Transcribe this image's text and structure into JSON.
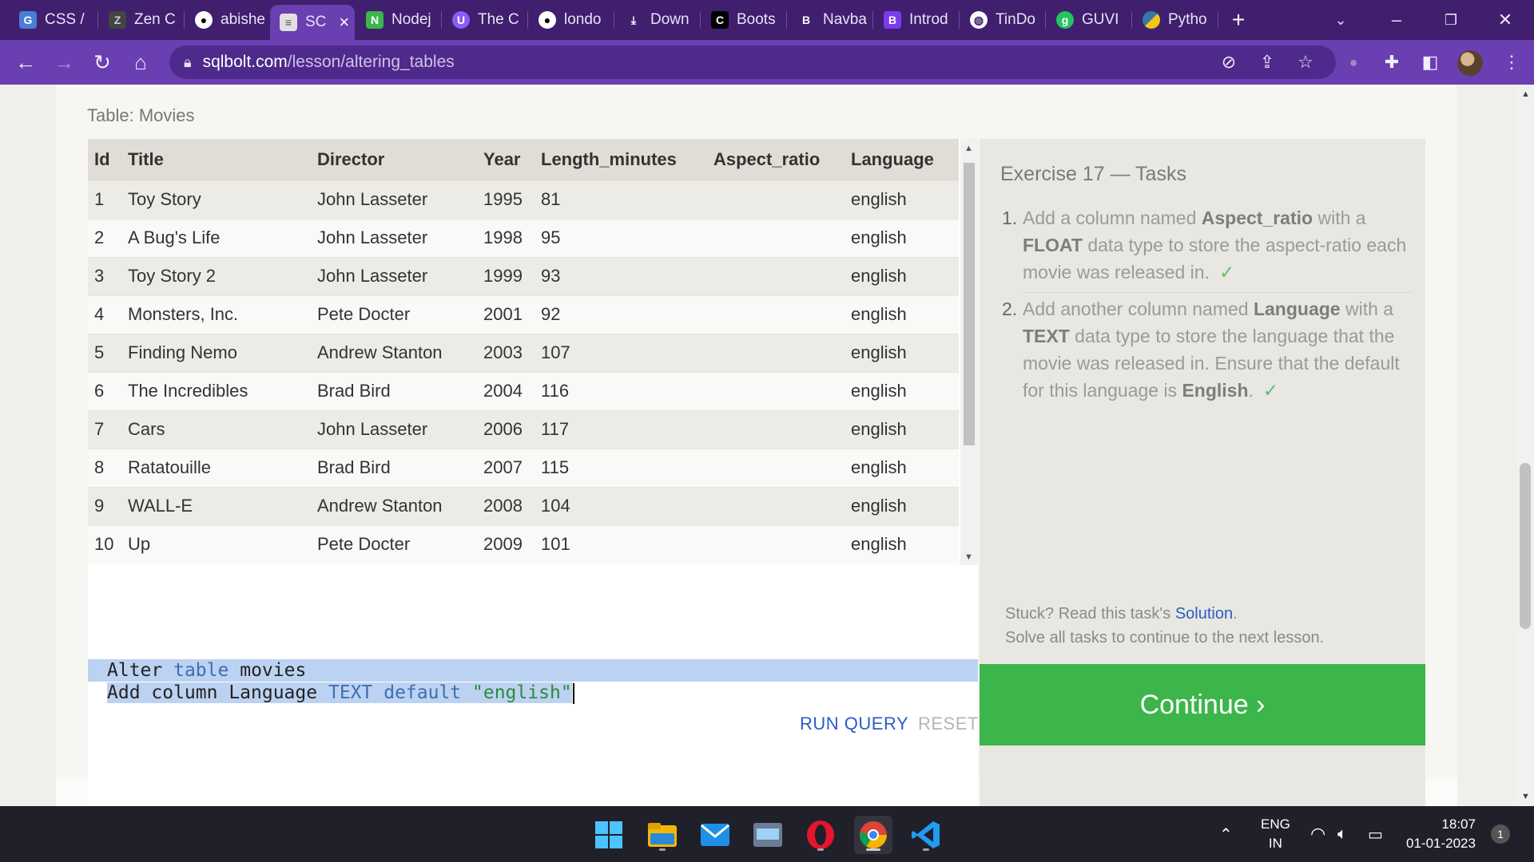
{
  "browser": {
    "tabs": [
      {
        "label": "CSS /",
        "icon": "docs-icon",
        "color": "#4a7fd6"
      },
      {
        "label": "Zen C",
        "icon": "zen-icon",
        "color": "#444444"
      },
      {
        "label": "abishe",
        "icon": "github-icon",
        "color": "#ffffff"
      },
      {
        "label": "SC",
        "icon": "database-icon",
        "color": "#e0e0e0"
      },
      {
        "label": "Nodej",
        "icon": "nodejs-icon",
        "color": "#3cb54a"
      },
      {
        "label": "The C",
        "icon": "theC-icon",
        "color": "#8b5cf6"
      },
      {
        "label": "londo",
        "icon": "github-icon",
        "color": "#ffffff"
      },
      {
        "label": "Down",
        "icon": "download-icon",
        "color": "#ffffff"
      },
      {
        "label": "Boots",
        "icon": "codecademy-icon",
        "color": "#000000"
      },
      {
        "label": "Navba",
        "icon": "bootstrap-icon",
        "color": "#3f1f6e"
      },
      {
        "label": "Introd",
        "icon": "bootstrap-icon",
        "color": "#7c3aed"
      },
      {
        "label": "TinDo",
        "icon": "globe-icon",
        "color": "#ffffff"
      },
      {
        "label": "GUVI",
        "icon": "guvi-icon",
        "color": "#22c55e"
      },
      {
        "label": "Pytho",
        "icon": "python-icon",
        "color": "#f5c518"
      }
    ],
    "new_tab": "+",
    "url_domain": "sqlbolt.com",
    "url_path": "/lesson/altering_tables"
  },
  "table": {
    "caption": "Table: Movies",
    "columns": [
      "Id",
      "Title",
      "Director",
      "Year",
      "Length_minutes",
      "Aspect_ratio",
      "Language"
    ],
    "rows": [
      [
        "1",
        "Toy Story",
        "John Lasseter",
        "1995",
        "81",
        "",
        "english"
      ],
      [
        "2",
        "A Bug's Life",
        "John Lasseter",
        "1998",
        "95",
        "",
        "english"
      ],
      [
        "3",
        "Toy Story 2",
        "John Lasseter",
        "1999",
        "93",
        "",
        "english"
      ],
      [
        "4",
        "Monsters, Inc.",
        "Pete Docter",
        "2001",
        "92",
        "",
        "english"
      ],
      [
        "5",
        "Finding Nemo",
        "Andrew Stanton",
        "2003",
        "107",
        "",
        "english"
      ],
      [
        "6",
        "The Incredibles",
        "Brad Bird",
        "2004",
        "116",
        "",
        "english"
      ],
      [
        "7",
        "Cars",
        "John Lasseter",
        "2006",
        "117",
        "",
        "english"
      ],
      [
        "8",
        "Ratatouille",
        "Brad Bird",
        "2007",
        "115",
        "",
        "english"
      ],
      [
        "9",
        "WALL-E",
        "Andrew Stanton",
        "2008",
        "104",
        "",
        "english"
      ],
      [
        "10",
        "Up",
        "Pete Docter",
        "2009",
        "101",
        "",
        "english"
      ]
    ]
  },
  "editor": {
    "line1": {
      "kw1": "Alter",
      "kw2": "table",
      "rest": "movies"
    },
    "line2": {
      "a": "Add column Language",
      "type": "TEXT",
      "default": "default",
      "value": "\"english\""
    },
    "run_label": "RUN QUERY",
    "reset_label": "RESET"
  },
  "tasks": {
    "title": "Exercise 17 — Tasks",
    "items": [
      {
        "num": "1.",
        "pre": "Add a column named ",
        "b1": "Aspect_ratio",
        "mid": " with a ",
        "b2": "FLOAT",
        "post": " data type to store the aspect-ratio each movie was released in.",
        "check": "✓"
      },
      {
        "num": "2.",
        "pre": "Add another column named ",
        "b1": "Language",
        "mid": " with a ",
        "b2": "TEXT",
        "post": " data type to store the language that the movie was released in. Ensure that the default for this language is ",
        "b3": "English",
        "end": ".",
        "check": "✓"
      }
    ],
    "stuck_pre": "Stuck? Read this task's ",
    "stuck_link": "Solution",
    "stuck_post": ".",
    "solve_all": "Solve all tasks to continue to the next lesson.",
    "continue_label": "Continue ›"
  },
  "taskbar": {
    "lang": "ENG",
    "region": "IN",
    "time": "18:07",
    "date": "01-01-2023",
    "notif_count": "1"
  }
}
